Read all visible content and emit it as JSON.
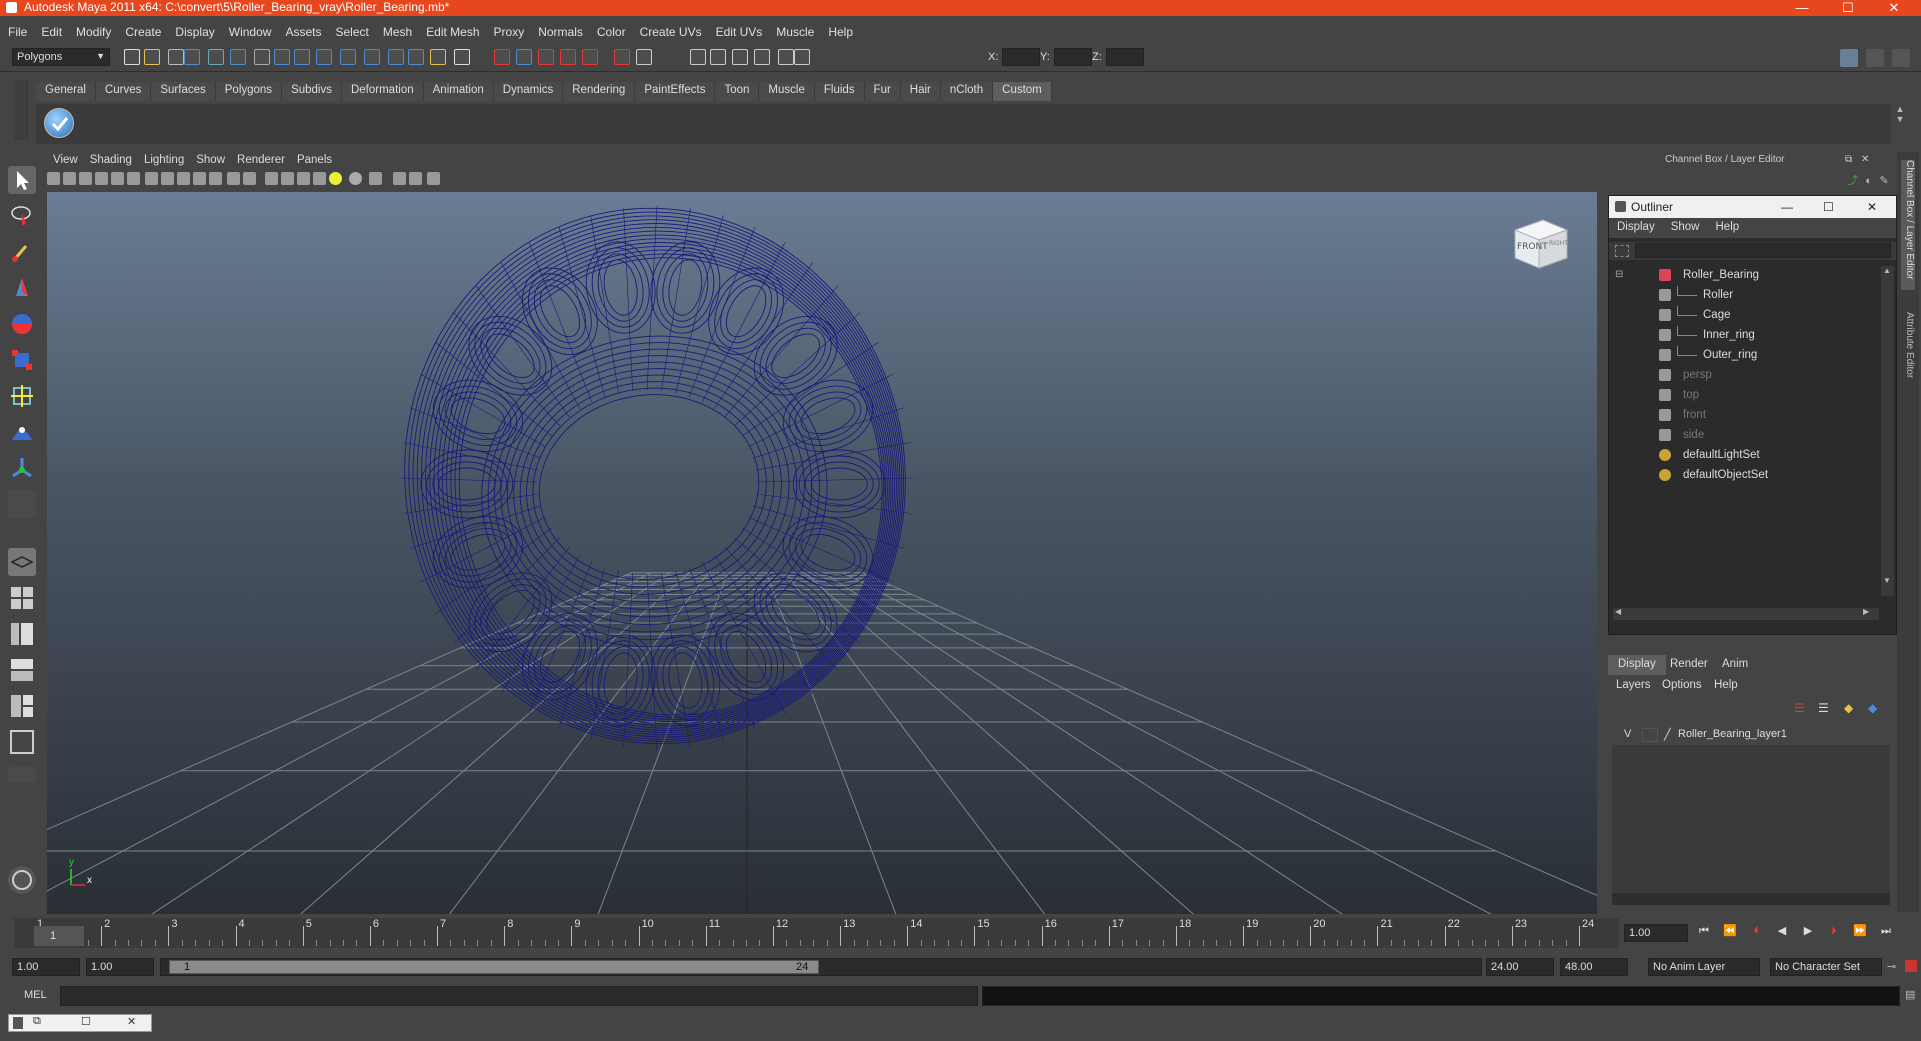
{
  "window": {
    "title": "Autodesk Maya 2011 x64: C:\\convert\\5\\Roller_Bearing_vray\\Roller_Bearing.mb*",
    "minimize": "—",
    "maximize": "☐",
    "close": "✕"
  },
  "menubar": [
    "File",
    "Edit",
    "Modify",
    "Create",
    "Display",
    "Window",
    "Assets",
    "Select",
    "Mesh",
    "Edit Mesh",
    "Proxy",
    "Normals",
    "Color",
    "Create UVs",
    "Edit UVs",
    "Muscle",
    "Help"
  ],
  "statusline": {
    "mode": "Polygons",
    "x_label": "X:",
    "y_label": "Y:",
    "z_label": "Z:"
  },
  "shelf_tabs": [
    "General",
    "Curves",
    "Surfaces",
    "Polygons",
    "Subdivs",
    "Deformation",
    "Animation",
    "Dynamics",
    "Rendering",
    "PaintEffects",
    "Toon",
    "Muscle",
    "Fluids",
    "Fur",
    "Hair",
    "nCloth",
    "Custom"
  ],
  "shelf_active": "Custom",
  "viewport": {
    "menu": [
      "View",
      "Shading",
      "Lighting",
      "Show",
      "Renderer",
      "Panels"
    ],
    "viewcube_front": "FRONT",
    "viewcube_side": "RIGHT",
    "axis_x": "x",
    "axis_y": "y",
    "colors": {
      "wire": "#1a1a7a",
      "grid": "#7d8590"
    }
  },
  "right_panel": {
    "title": "Channel Box / Layer Editor",
    "side_tab_1": "Channel Box / Layer Editor",
    "side_tab_2": "Attribute Editor"
  },
  "outliner": {
    "title": "Outliner",
    "menu": [
      "Display",
      "Show",
      "Help"
    ],
    "items": [
      {
        "label": "Roller_Bearing",
        "dim": false
      },
      {
        "label": "Roller",
        "dim": false
      },
      {
        "label": "Cage",
        "dim": false
      },
      {
        "label": "Inner_ring",
        "dim": false
      },
      {
        "label": "Outer_ring",
        "dim": false
      },
      {
        "label": "persp",
        "dim": true
      },
      {
        "label": "top",
        "dim": true
      },
      {
        "label": "front",
        "dim": true
      },
      {
        "label": "side",
        "dim": true
      },
      {
        "label": "defaultLightSet",
        "dim": false
      },
      {
        "label": "defaultObjectSet",
        "dim": false
      }
    ]
  },
  "layers": {
    "tabs": [
      "Display",
      "Render",
      "Anim"
    ],
    "menu": [
      "Layers",
      "Options",
      "Help"
    ],
    "layer_visible": "V",
    "layer_name": "Roller_Bearing_layer1"
  },
  "timeline": {
    "ticks": [
      "1",
      "2",
      "3",
      "4",
      "5",
      "6",
      "7",
      "8",
      "9",
      "10",
      "11",
      "12",
      "13",
      "14",
      "15",
      "16",
      "17",
      "18",
      "19",
      "20",
      "21",
      "22",
      "23",
      "24"
    ],
    "current_frame_label": "1",
    "current_time": "1.00"
  },
  "range": {
    "start": "1.00",
    "playback_start": "1.00",
    "slider_start": "1",
    "slider_end": "24",
    "playback_end": "24.00",
    "end": "48.00",
    "anim_layer": "No Anim Layer",
    "character_set": "No Character Set"
  },
  "cmdline": {
    "label": "MEL"
  }
}
